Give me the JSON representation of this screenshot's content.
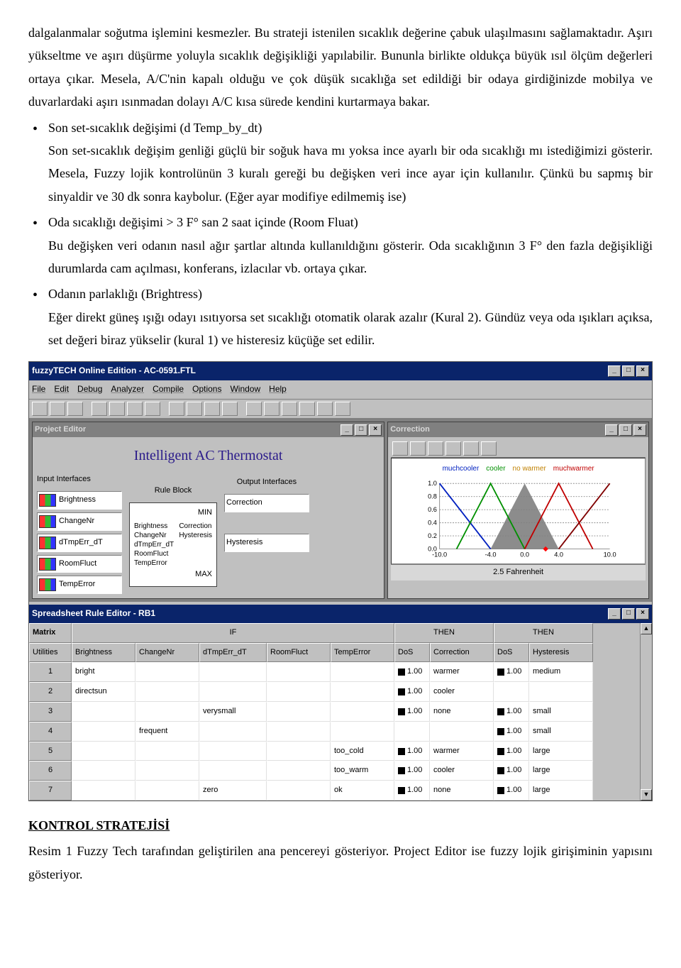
{
  "intro": "dalgalanmalar soğutma işlemini kesmezler. Bu strateji istenilen sıcaklık değerine çabuk ulaşılmasını sağlamaktadır. Aşırı yükseltme ve aşırı düşürme yoluyla sıcaklık değişikliği yapılabilir. Bununla birlikte oldukça büyük ısıl ölçüm değerleri ortaya çıkar. Mesela, A/C'nin kapalı olduğu ve çok düşük sıcaklığa set edildiği bir odaya girdiğinizde mobilya ve duvarlardaki aşırı ısınmadan dolayı A/C kısa sürede kendini kurtarmaya bakar.",
  "bullets": [
    {
      "title": "Son set-sıcaklık değişimi (d Temp_by_dt)",
      "body": "Son set-sıcaklık değişim genliği güçlü bir soğuk hava mı yoksa ince ayarlı bir oda sıcaklığı mı istediğimizi gösterir. Mesela, Fuzzy lojik kontrolünün 3 kuralı gereği bu değişken veri ince ayar için kullanılır. Çünkü bu sapmış bir sinyaldir ve 30 dk sonra kaybolur. (Eğer ayar modifiye edilmemiş ise)"
    },
    {
      "title": "Oda sıcaklığı değişimi > 3 F° san 2 saat içinde (Room Fluat)",
      "body": "Bu değişken veri odanın nasıl ağır şartlar altında kullanıldığını gösterir. Oda sıcaklığının 3 F° den fazla değişikliği durumlarda cam açılması, konferans, izlacılar vb. ortaya çıkar."
    },
    {
      "title": "Odanın parlaklığı (Brightress)",
      "body": "Eğer direkt güneş ışığı odayı ısıtıyorsa set sıcaklığı otomatik olarak azalır (Kural 2). Gündüz veya oda ışıkları açıksa, set değeri biraz yükselir (kural 1) ve histeresiz küçüğe set edilir."
    }
  ],
  "app": {
    "title": "fuzzyTECH Online Edition - AC-0591.FTL",
    "menu": [
      "File",
      "Edit",
      "Debug",
      "Analyzer",
      "Compile",
      "Options",
      "Window",
      "Help"
    ],
    "project_editor": {
      "title": "Project Editor",
      "heading": "Intelligent AC Thermostat",
      "input_label": "Input Interfaces",
      "output_label": "Output Interfaces",
      "rule_label": "Rule Block",
      "inputs": [
        "Brightness",
        "ChangeNr",
        "dTmpErr_dT",
        "RoomFluct",
        "TempError"
      ],
      "outputs": [
        "Correction",
        "Hysteresis"
      ],
      "ruleblock": {
        "min": "MIN",
        "max": "MAX",
        "left": [
          "Brightness",
          "ChangeNr",
          "dTmpErr_dT",
          "RoomFluct",
          "TempError"
        ],
        "right": [
          "Correction",
          "Hysteresis"
        ]
      }
    },
    "correction": {
      "title": "Correction",
      "legend": [
        "muchcooler",
        "cooler",
        "no warmer",
        "muchwarmer"
      ],
      "xaxis_caption": "2.5 Fahrenheit"
    },
    "rule_editor": {
      "title": "Spreadsheet Rule Editor - RB1",
      "group_if": "IF",
      "group_then": "THEN",
      "col_matrix": "Matrix",
      "col_util": "Utilities",
      "cols_if": [
        "Brightness",
        "ChangeNr",
        "dTmpErr_dT",
        "RoomFluct",
        "TempError"
      ],
      "col_dos": "DoS",
      "col_correction": "Correction",
      "col_hysteresis": "Hysteresis",
      "rows": [
        {
          "n": "1",
          "Brightness": "bright",
          "ChangeNr": "",
          "dTmpErr_dT": "",
          "RoomFluct": "",
          "TempError": "",
          "DoS1": "1.00",
          "Correction": "warmer",
          "DoS2": "1.00",
          "Hysteresis": "medium"
        },
        {
          "n": "2",
          "Brightness": "directsun",
          "ChangeNr": "",
          "dTmpErr_dT": "",
          "RoomFluct": "",
          "TempError": "",
          "DoS1": "1.00",
          "Correction": "cooler",
          "DoS2": "",
          "Hysteresis": ""
        },
        {
          "n": "3",
          "Brightness": "",
          "ChangeNr": "",
          "dTmpErr_dT": "verysmall",
          "RoomFluct": "",
          "TempError": "",
          "DoS1": "1.00",
          "Correction": "none",
          "DoS2": "1.00",
          "Hysteresis": "small"
        },
        {
          "n": "4",
          "Brightness": "",
          "ChangeNr": "frequent",
          "dTmpErr_dT": "",
          "RoomFluct": "",
          "TempError": "",
          "DoS1": "",
          "Correction": "",
          "DoS2": "1.00",
          "Hysteresis": "small"
        },
        {
          "n": "5",
          "Brightness": "",
          "ChangeNr": "",
          "dTmpErr_dT": "",
          "RoomFluct": "",
          "TempError": "too_cold",
          "DoS1": "1.00",
          "Correction": "warmer",
          "DoS2": "1.00",
          "Hysteresis": "large"
        },
        {
          "n": "6",
          "Brightness": "",
          "ChangeNr": "",
          "dTmpErr_dT": "",
          "RoomFluct": "",
          "TempError": "too_warm",
          "DoS1": "1.00",
          "Correction": "cooler",
          "DoS2": "1.00",
          "Hysteresis": "large"
        },
        {
          "n": "7",
          "Brightness": "",
          "ChangeNr": "",
          "dTmpErr_dT": "zero",
          "RoomFluct": "",
          "TempError": "ok",
          "DoS1": "1.00",
          "Correction": "none",
          "DoS2": "1.00",
          "Hysteresis": "large"
        }
      ]
    }
  },
  "section_title": "KONTROL STRATEJİSİ",
  "outro": "Resim 1 Fuzzy Tech tarafından geliştirilen ana pencereyi gösteriyor. Project Editor ise fuzzy lojik girişiminin yapısını gösteriyor.",
  "chart_data": {
    "type": "line",
    "title": "Correction",
    "xlabel": "2.5 Fahrenheit",
    "ylabel": "",
    "xlim": [
      -10,
      10
    ],
    "ylim": [
      0,
      1
    ],
    "x_ticks": [
      -10.0,
      -4.0,
      0.0,
      4.0,
      10.0
    ],
    "y_ticks": [
      0.0,
      0.2,
      0.4,
      0.6,
      0.8,
      1.0
    ],
    "series": [
      {
        "name": "muchcooler",
        "color": "#0020c0",
        "points": [
          [
            -10,
            1
          ],
          [
            -4,
            0
          ]
        ]
      },
      {
        "name": "cooler",
        "color": "#009000",
        "points": [
          [
            -8,
            0
          ],
          [
            -4,
            1
          ],
          [
            0,
            0
          ]
        ]
      },
      {
        "name": "none_shaded",
        "color": "#808080",
        "fill": true,
        "points": [
          [
            -4,
            0
          ],
          [
            0,
            1
          ],
          [
            4,
            0
          ]
        ]
      },
      {
        "name": "no warmer",
        "color": "#c00000",
        "points": [
          [
            0,
            0
          ],
          [
            4,
            1
          ],
          [
            8,
            0
          ]
        ]
      },
      {
        "name": "muchwarmer",
        "color": "#800000",
        "points": [
          [
            4,
            0
          ],
          [
            10,
            1
          ]
        ]
      }
    ],
    "markers": [
      {
        "x": 2.5,
        "color": "#ff0000",
        "shape": "diamond"
      }
    ]
  }
}
